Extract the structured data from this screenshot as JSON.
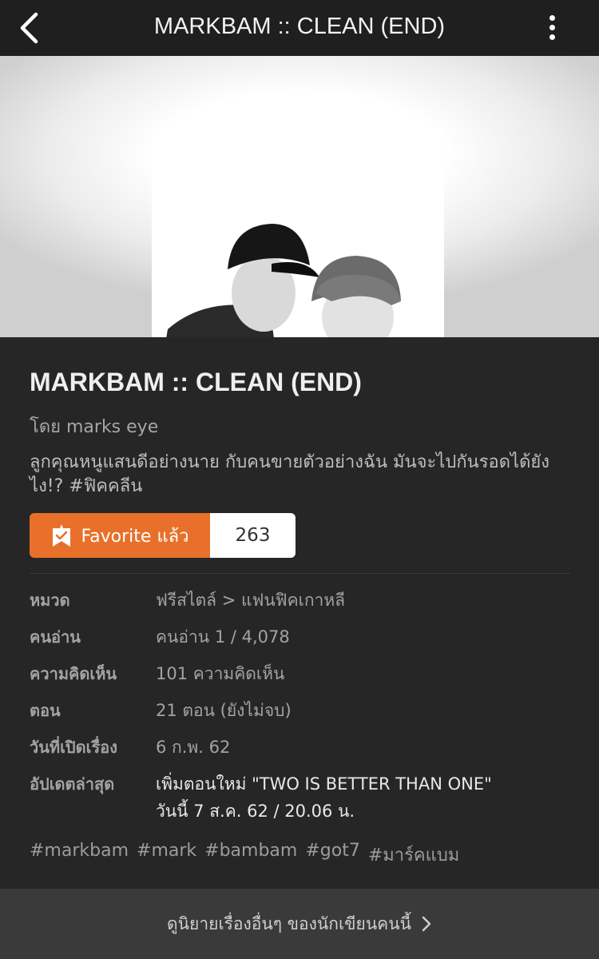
{
  "header": {
    "title": "MARKBAM :: CLEAN (END)",
    "back_icon": "chevron-left-icon",
    "more_icon": "more-vertical-icon"
  },
  "story": {
    "title": "MARKBAM :: CLEAN (END)",
    "author": "โดย marks eye",
    "description": "ลูกคุณหนูแสนดีอย่างนาย กับคนขายตัวอย่างฉัน มันจะไปกันรอดได้ยังไง!? #ฟิคคลีน"
  },
  "favorite": {
    "label": "Favorite แล้ว",
    "count": "263",
    "icon": "bookmark-check-icon",
    "color": "#e8702a"
  },
  "meta": {
    "category": {
      "key": "หมวด",
      "value": "ฟรีสไตล์ > แฟนฟิคเกาหลี"
    },
    "readers": {
      "key": "คนอ่าน",
      "value": "คนอ่าน 1 / 4,078"
    },
    "comments": {
      "key": "ความคิดเห็น",
      "value": "101 ความคิดเห็น"
    },
    "chapters": {
      "key": "ตอน",
      "value": "21 ตอน (ยังไม่จบ)"
    },
    "opened": {
      "key": "วันที่เปิดเรื่อง",
      "value": "6 ก.พ. 62"
    },
    "updated": {
      "key": "อัปเดตล่าสุด",
      "line1": "เพิ่มตอนใหม่ \"TWO IS BETTER THAN ONE\"",
      "line2": "วันนี้ 7 ส.ค. 62 / 20.06 น."
    }
  },
  "tags": [
    "#markbam",
    "#mark",
    "#bambam",
    "#got7",
    "#มาร์คแบม"
  ],
  "footer": {
    "link_label": "ดูนิยายเรื่องอื่นๆ ของนักเขียนคนนี้",
    "icon": "chevron-right-icon"
  },
  "colors": {
    "background": "#262626",
    "topbar": "#1f1f1f",
    "accent": "#e8702a",
    "footer": "#3a3a3a"
  }
}
